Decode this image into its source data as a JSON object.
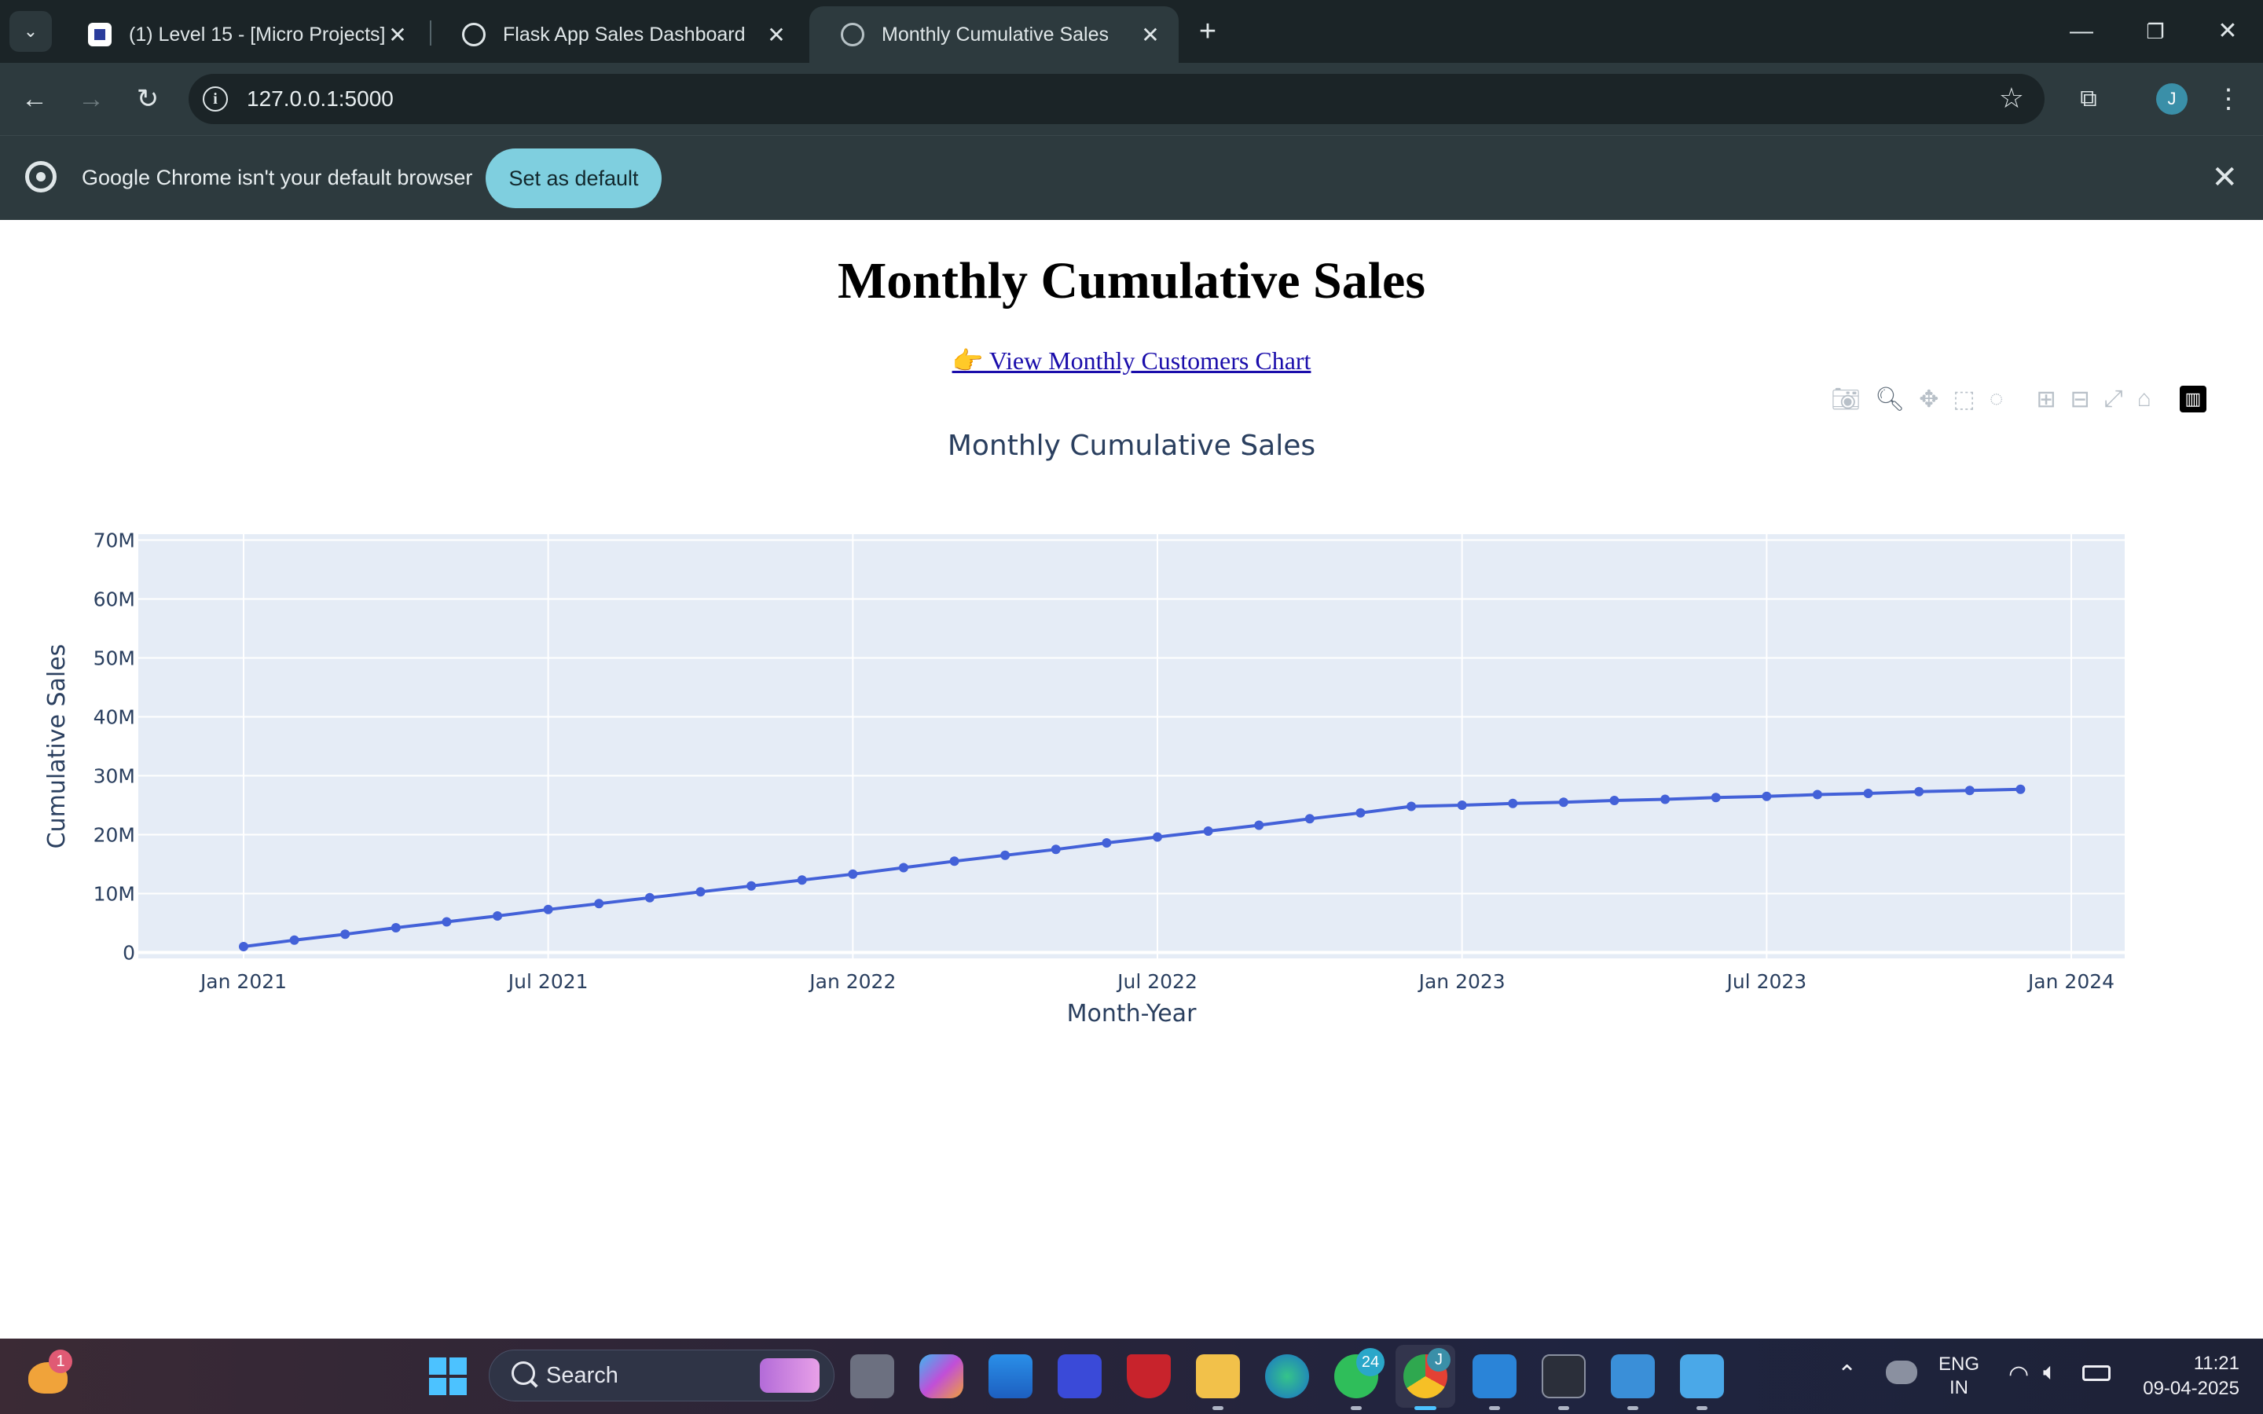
{
  "browser": {
    "tabs": [
      {
        "title": "(1) Level 15 - [Micro Projects]",
        "active": false
      },
      {
        "title": "Flask App Sales Dashboard",
        "active": false
      },
      {
        "title": "Monthly Cumulative Sales",
        "active": true
      }
    ],
    "url": "127.0.0.1:5000",
    "profile_initial": "J",
    "infobar": {
      "message": "Google Chrome isn't your default browser",
      "button": "Set as default"
    }
  },
  "page": {
    "heading": "Monthly Cumulative Sales",
    "link_text": "👉 View Monthly Customers Chart"
  },
  "chart_data": {
    "type": "line",
    "title": "Monthly Cumulative Sales",
    "xlabel": "Month-Year",
    "ylabel": "Cumulative Sales",
    "x_ticks": [
      "Jan 2021",
      "Jul 2021",
      "Jan 2022",
      "Jul 2022",
      "Jan 2023",
      "Jul 2023",
      "Jan 2024"
    ],
    "y_ticks": [
      "0",
      "10M",
      "20M",
      "30M",
      "40M",
      "50M",
      "60M",
      "70M"
    ],
    "ylim": [
      -1,
      71
    ],
    "x": [
      "2021-01",
      "2021-02",
      "2021-03",
      "2021-04",
      "2021-05",
      "2021-06",
      "2021-07",
      "2021-08",
      "2021-09",
      "2021-10",
      "2021-11",
      "2021-12",
      "2022-01",
      "2022-02",
      "2022-03",
      "2022-04",
      "2022-05",
      "2022-06",
      "2022-07",
      "2022-08",
      "2022-09",
      "2022-10",
      "2022-11",
      "2022-12",
      "2023-01",
      "2023-02",
      "2023-03",
      "2023-04",
      "2023-05",
      "2023-06",
      "2023-07",
      "2023-08",
      "2023-09",
      "2023-10",
      "2023-11",
      "2023-12"
    ],
    "series": [
      {
        "values": [
          1.0,
          2.1,
          3.1,
          4.2,
          5.2,
          6.2,
          7.3,
          8.3,
          9.3,
          10.3,
          11.3,
          12.3,
          13.3,
          14.4,
          15.5,
          16.5,
          17.5,
          18.6,
          19.6,
          20.6,
          21.6,
          22.7,
          23.7,
          24.8,
          25.0,
          25.3,
          25.5,
          25.8,
          26.0,
          26.3,
          26.5,
          26.8,
          27.0,
          27.3,
          27.5,
          27.7
        ]
      }
    ],
    "line_color": "#4361d8",
    "grid": true
  },
  "modebar": {
    "buttons": [
      "camera-icon",
      "zoom-icon",
      "pan-icon",
      "box-select-icon",
      "lasso-select-icon",
      "zoom-in-icon",
      "zoom-out-icon",
      "autoscale-icon",
      "reset-axes-icon",
      "plotly-logo-icon"
    ]
  },
  "taskbar": {
    "weather_badge": "1",
    "search_label": "Search",
    "whatsapp_badge": "24",
    "chrome_badge": "J",
    "lang_line1": "ENG",
    "lang_line2": "IN",
    "time": "11:21",
    "date": "09-04-2025"
  }
}
